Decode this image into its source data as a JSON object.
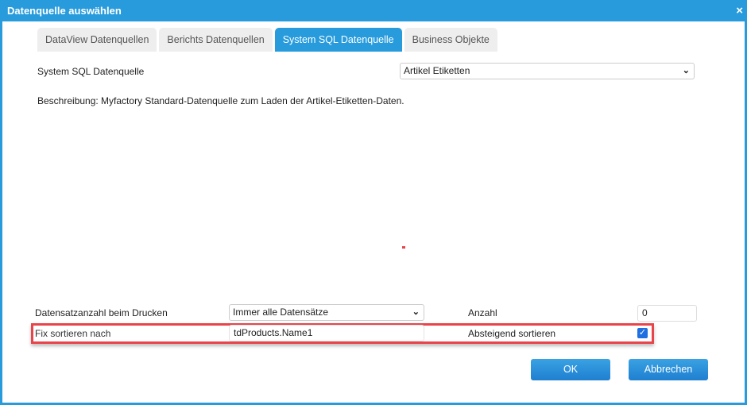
{
  "window": {
    "title": "Datenquelle auswählen",
    "close": "×"
  },
  "tabs": [
    {
      "label": "DataView Datenquellen"
    },
    {
      "label": "Berichts Datenquellen"
    },
    {
      "label": "System SQL Datenquelle"
    },
    {
      "label": "Business Objekte"
    }
  ],
  "source": {
    "label": "System SQL Datenquelle",
    "value": "Artikel Etiketten"
  },
  "description": "Beschreibung: Myfactory Standard-Datenquelle zum Laden der Artikel-Etiketten-Daten.",
  "print_count": {
    "label": "Datensatzanzahl beim Drucken",
    "value": "Immer alle Datensätze"
  },
  "count": {
    "label": "Anzahl",
    "value": "0"
  },
  "sort": {
    "label": "Fix sortieren nach",
    "value": "tdProducts.Name1"
  },
  "descending": {
    "label": "Absteigend sortieren",
    "checked": true
  },
  "buttons": {
    "ok": "OK",
    "cancel": "Abbrechen"
  }
}
